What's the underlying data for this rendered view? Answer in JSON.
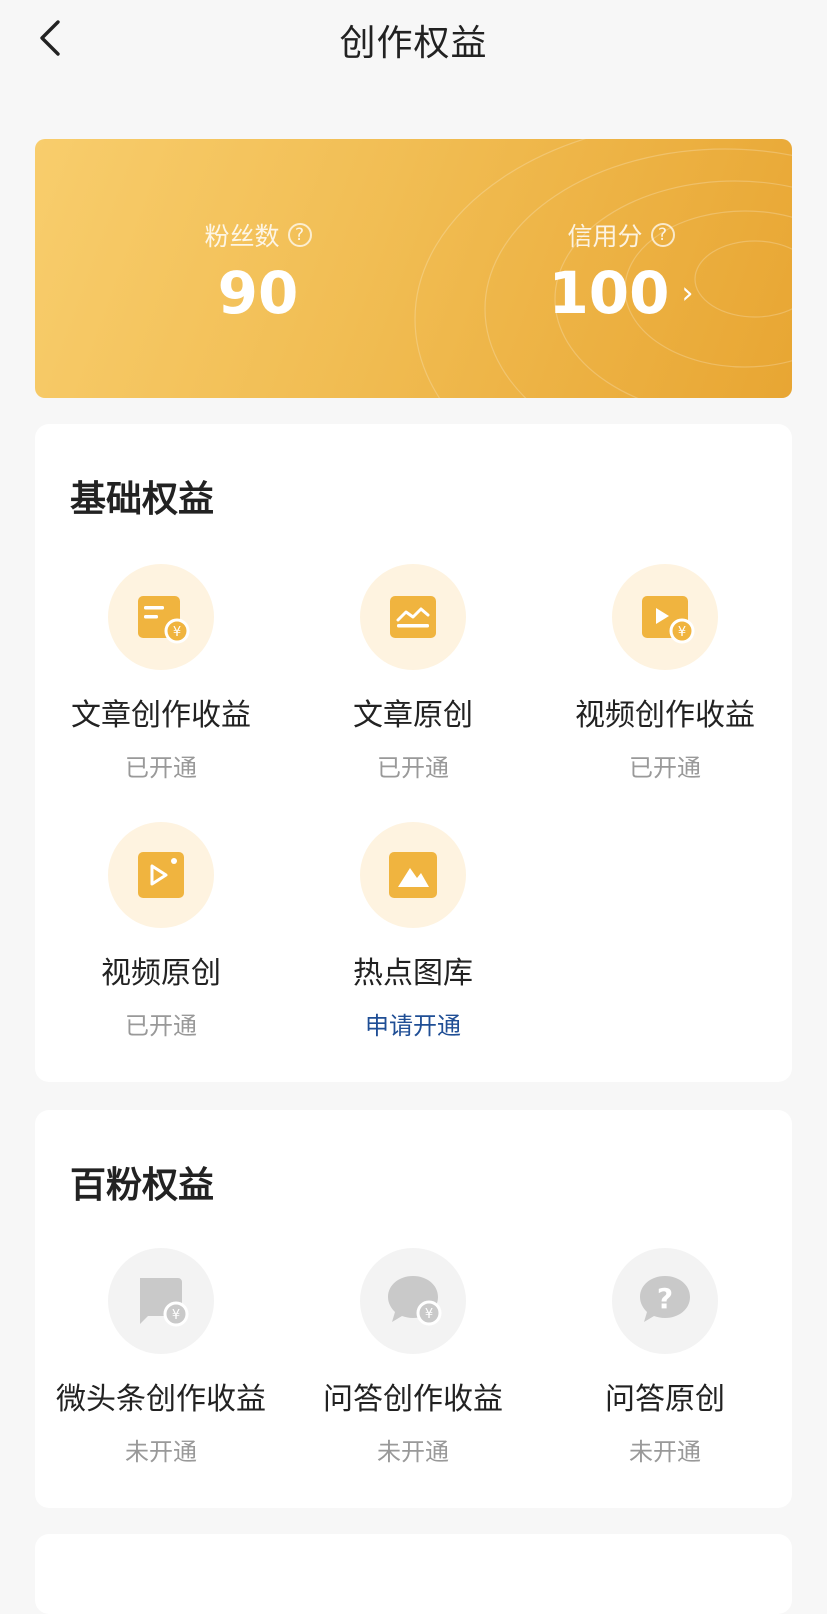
{
  "nav": {
    "title": "创作权益"
  },
  "banner": {
    "fans": {
      "label": "粉丝数",
      "value": "90"
    },
    "credit": {
      "label": "信用分",
      "value": "100"
    },
    "help_glyph": "?",
    "arrow_glyph": "›"
  },
  "basic": {
    "title": "基础权益",
    "items": [
      {
        "label": "文章创作收益",
        "status": "已开通",
        "icon": "article-income-icon"
      },
      {
        "label": "文章原创",
        "status": "已开通",
        "icon": "article-original-icon"
      },
      {
        "label": "视频创作收益",
        "status": "已开通",
        "icon": "video-income-icon"
      },
      {
        "label": "视频原创",
        "status": "已开通",
        "icon": "video-original-icon"
      },
      {
        "label": "热点图库",
        "status": "申请开通",
        "icon": "hot-gallery-icon"
      }
    ]
  },
  "hundred": {
    "title": "百粉权益",
    "items": [
      {
        "label": "微头条创作收益",
        "status": "未开通",
        "icon": "micro-post-income-icon"
      },
      {
        "label": "问答创作收益",
        "status": "未开通",
        "icon": "qa-income-icon"
      },
      {
        "label": "问答原创",
        "status": "未开通",
        "icon": "qa-original-icon"
      }
    ]
  },
  "colors": {
    "banner_start": "#f8cd6c",
    "banner_end": "#e8a633",
    "icon_gold": "#f0b43f",
    "icon_bg_gold": "#fef3e0",
    "icon_gray": "#c9c9c9",
    "link_blue": "#1f4e95",
    "status_gray": "#999999"
  }
}
